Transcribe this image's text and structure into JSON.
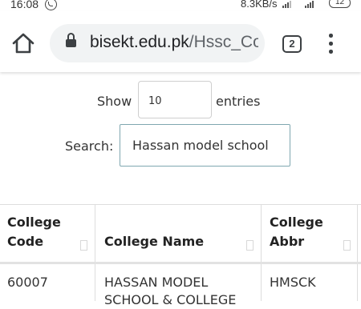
{
  "status_bar": {
    "time": "16:08",
    "network_speed": "8.3KB/s",
    "battery": "12"
  },
  "browser": {
    "url_domain": "bisekt.edu.pk",
    "url_path": "/Hssc_Co",
    "tab_count": "2"
  },
  "controls": {
    "show_label": "Show",
    "entries_value": "10",
    "entries_label": "entries",
    "search_label": "Search:",
    "search_value": "Hassan model school"
  },
  "table": {
    "headers": [
      {
        "line1": "College",
        "line2": "Code"
      },
      {
        "line1": "",
        "line2": "College Name"
      },
      {
        "line1": "College",
        "line2": "Abbr"
      }
    ],
    "rows": [
      {
        "code": "60007",
        "name_line1": "HASSAN MODEL",
        "name_line2": "SCHOOL & COLLEGE",
        "abbr": "HMSCK"
      }
    ]
  }
}
